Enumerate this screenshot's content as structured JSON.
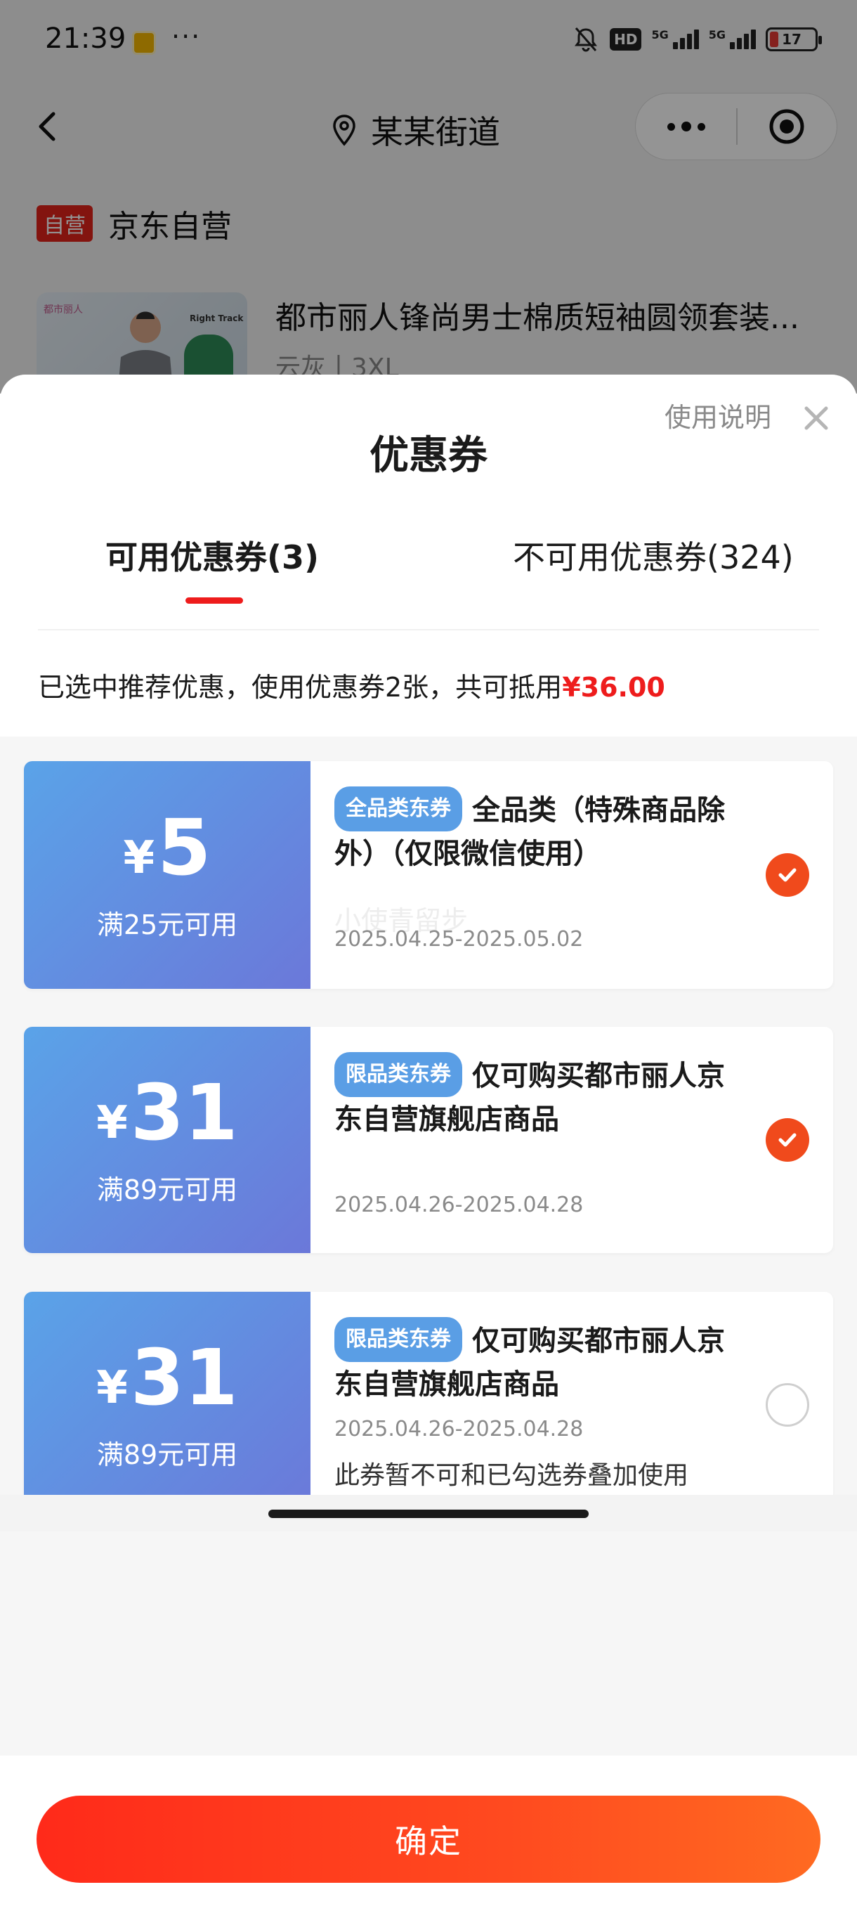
{
  "status_bar": {
    "time": "21:39",
    "more": "···",
    "hd": "HD",
    "net1": "5G",
    "net2": "5G",
    "battery": "17",
    "battery_color": "#e53935"
  },
  "nav": {
    "title": "某某街道",
    "icons": [
      "back-icon",
      "location-icon",
      "more-icon",
      "close-target-icon"
    ]
  },
  "shop": {
    "badge": "自营",
    "name": "京东自营"
  },
  "product": {
    "title": "都市丽人锋尚男士棉质短袖圆领套装...",
    "spec": "云灰丨3XL",
    "thumb_brand": "都市丽人",
    "thumb_sign": "Right Track"
  },
  "sheet": {
    "title": "优惠券",
    "help_link": "使用说明",
    "tabs": [
      {
        "label": "可用优惠券(3)",
        "active": true
      },
      {
        "label": "不可用优惠券(324)",
        "active": false
      }
    ],
    "summary_prefix": "已选中推荐优惠，使用优惠券2张，共可抵用",
    "summary_amount": "¥36.00"
  },
  "coupons": [
    {
      "currency": "¥",
      "value": "5",
      "condition": "满25元可用",
      "tag": "全品类东券",
      "title": "全品类（特殊商品除外）（仅限微信使用）",
      "watermark": "小使青留步",
      "date": "2025.04.25-2025.05.02",
      "note": "",
      "selected": true
    },
    {
      "currency": "¥",
      "value": "31",
      "condition": "满89元可用",
      "tag": "限品类东券",
      "title": "仅可购买都市丽人京东自营旗舰店商品",
      "date": "2025.04.26-2025.04.28",
      "note": "",
      "selected": true
    },
    {
      "currency": "¥",
      "value": "31",
      "condition": "满89元可用",
      "tag": "限品类东券",
      "title": "仅可购买都市丽人京东自营旗舰店商品",
      "date": "2025.04.26-2025.04.28",
      "note": "此券暂不可和已勾选券叠加使用",
      "selected": false
    }
  ],
  "footer": {
    "confirm_label": "确定"
  },
  "colors": {
    "accent_red": "#ee1c1c",
    "check_orange": "#f04a1c",
    "coupon_blue_start": "#5aa3e8",
    "coupon_blue_end": "#6b78d9",
    "tag_blue": "#5a9ee5"
  }
}
